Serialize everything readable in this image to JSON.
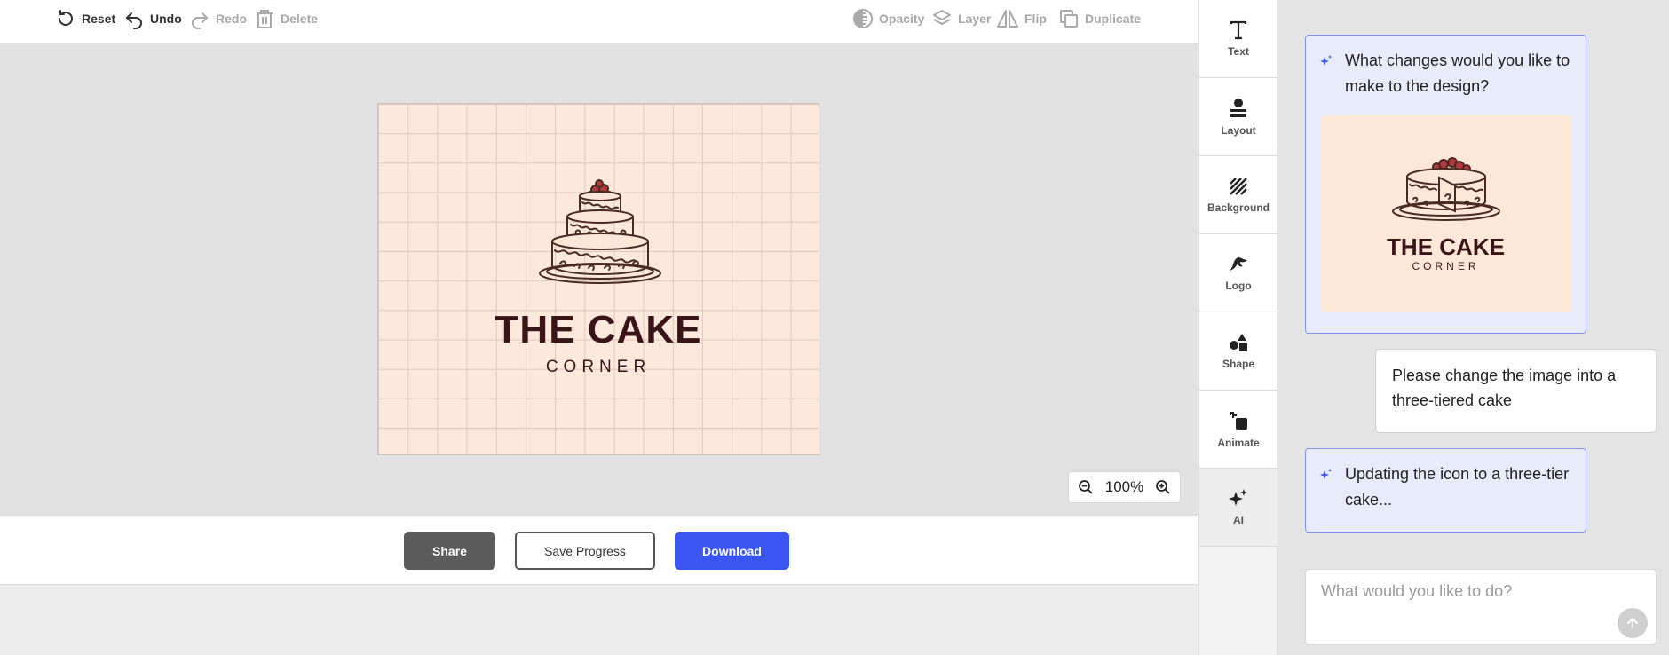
{
  "toolbar": {
    "reset": "Reset",
    "undo": "Undo",
    "redo": "Redo",
    "delete": "Delete",
    "opacity": "Opacity",
    "layer": "Layer",
    "flip": "Flip",
    "duplicate": "Duplicate"
  },
  "design": {
    "title": "THE CAKE",
    "subtitle": "CORNER",
    "icon": "three-tier-cake-icon"
  },
  "zoom": {
    "value": "100%"
  },
  "actions": {
    "share": "Share",
    "save": "Save Progress",
    "download": "Download"
  },
  "tools": [
    {
      "label": "Text",
      "icon": "text-icon"
    },
    {
      "label": "Layout",
      "icon": "layout-icon"
    },
    {
      "label": "Background",
      "icon": "background-icon"
    },
    {
      "label": "Logo",
      "icon": "logo-icon"
    },
    {
      "label": "Shape",
      "icon": "shape-icon"
    },
    {
      "label": "Animate",
      "icon": "animate-icon"
    },
    {
      "label": "AI",
      "icon": "sparkle-icon"
    }
  ],
  "chat": {
    "ai_question": "What changes would you like to make to the design?",
    "preview_title": "THE CAKE",
    "preview_subtitle": "CORNER",
    "user_message": "Please change the image into a three-tiered cake",
    "ai_status": "Updating the icon to a three-tier cake...",
    "input_placeholder": "What would you like to do?"
  },
  "colors": {
    "accent": "#3a55f2",
    "bubble_bg": "#e8ebfa",
    "bubble_border": "#7f92ee",
    "artboard_bg": "#fce9dc",
    "brand_text": "#3a1418"
  }
}
